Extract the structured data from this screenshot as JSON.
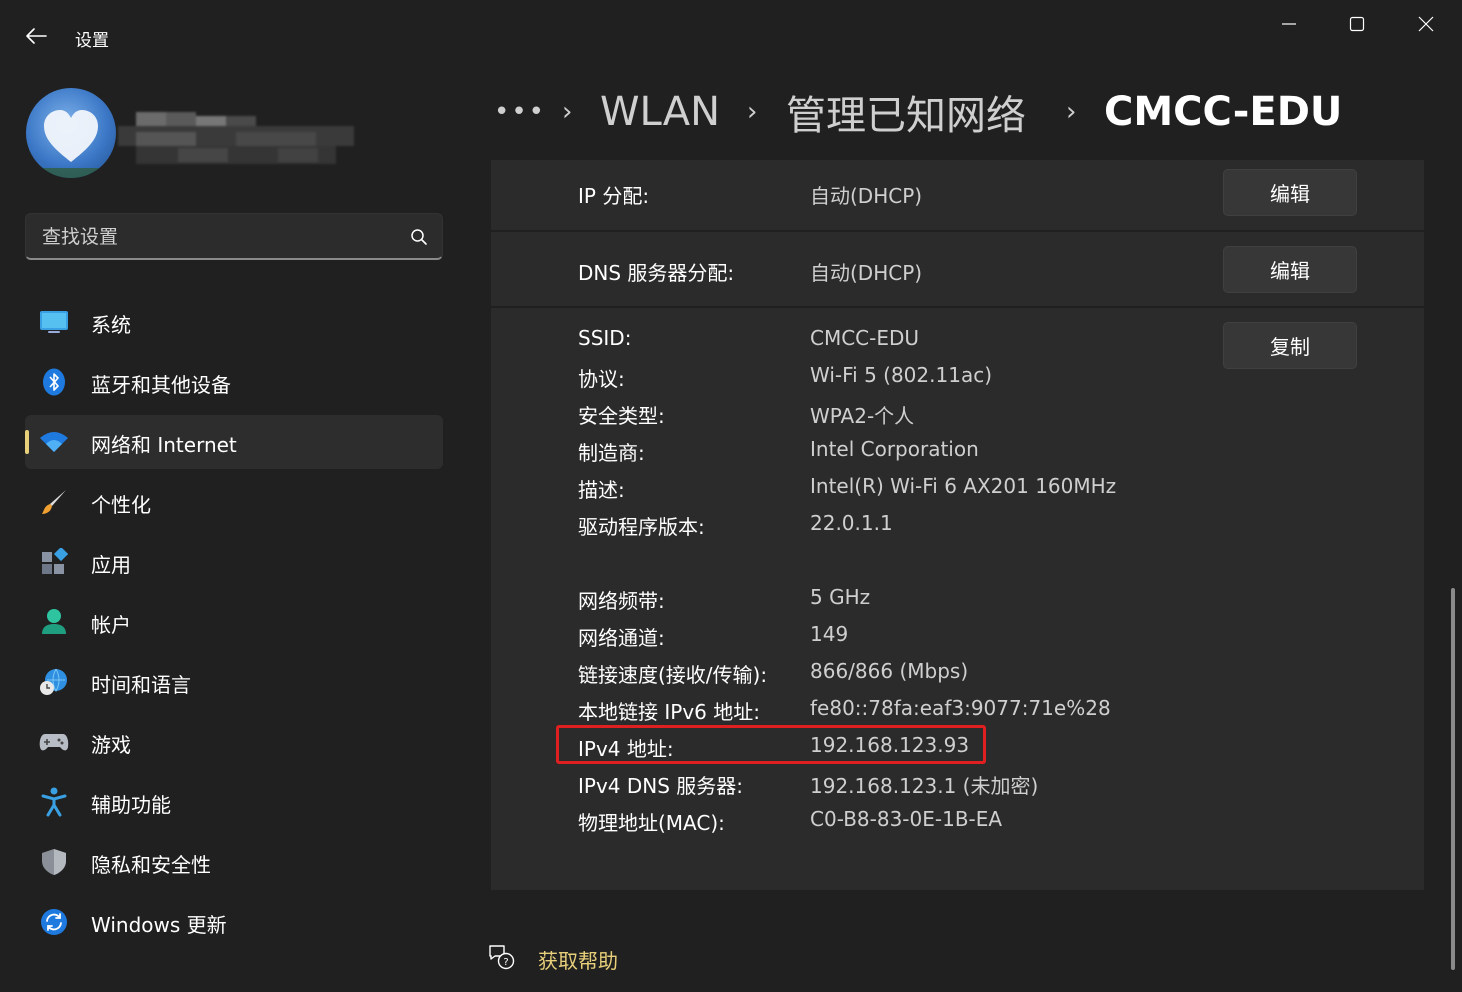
{
  "app": {
    "title": "设置"
  },
  "search": {
    "placeholder": "查找设置"
  },
  "nav": [
    {
      "label": "系统",
      "icon": "monitor-icon"
    },
    {
      "label": "蓝牙和其他设备",
      "icon": "bluetooth-icon"
    },
    {
      "label": "网络和 Internet",
      "icon": "wifi-icon",
      "selected": true
    },
    {
      "label": "个性化",
      "icon": "paintbrush-icon"
    },
    {
      "label": "应用",
      "icon": "apps-icon"
    },
    {
      "label": "帐户",
      "icon": "person-icon"
    },
    {
      "label": "时间和语言",
      "icon": "globe-clock-icon"
    },
    {
      "label": "游戏",
      "icon": "gamepad-icon"
    },
    {
      "label": "辅助功能",
      "icon": "accessibility-icon"
    },
    {
      "label": "隐私和安全性",
      "icon": "shield-icon"
    },
    {
      "label": "Windows 更新",
      "icon": "refresh-icon"
    }
  ],
  "breadcrumb": {
    "more": "•••",
    "items": [
      "WLAN",
      "管理已知网络",
      "CMCC-EDU"
    ]
  },
  "ip_assignment": {
    "label": "IP 分配:",
    "value": "自动(DHCP)",
    "button": "编辑"
  },
  "dns_assignment": {
    "label": "DNS 服务器分配:",
    "value": "自动(DHCP)",
    "button": "编辑"
  },
  "properties": {
    "copy_button": "复制",
    "group1": [
      {
        "label": "SSID:",
        "value": "CMCC-EDU"
      },
      {
        "label": "协议:",
        "value": "Wi-Fi 5 (802.11ac)"
      },
      {
        "label": "安全类型:",
        "value": "WPA2-个人"
      },
      {
        "label": "制造商:",
        "value": "Intel Corporation"
      },
      {
        "label": "描述:",
        "value": "Intel(R) Wi-Fi 6 AX201 160MHz"
      },
      {
        "label": "驱动程序版本:",
        "value": "22.0.1.1"
      }
    ],
    "group2": [
      {
        "label": "网络频带:",
        "value": "5 GHz"
      },
      {
        "label": "网络通道:",
        "value": "149"
      },
      {
        "label": "链接速度(接收/传输):",
        "value": "866/866 (Mbps)"
      },
      {
        "label": "本地链接 IPv6 地址:",
        "value": "fe80::78fa:eaf3:9077:71e%28"
      },
      {
        "label": "IPv4 地址:",
        "value": "192.168.123.93"
      },
      {
        "label": "IPv4 DNS 服务器:",
        "value": "192.168.123.1 (未加密)"
      },
      {
        "label": "物理地址(MAC):",
        "value": "C0-B8-83-0E-1B-EA"
      }
    ]
  },
  "help": {
    "label": "获取帮助"
  },
  "colors": {
    "accent": "#e8cf7a",
    "highlight": "#e02020",
    "card": "#2b2b2b",
    "background": "#202020"
  }
}
